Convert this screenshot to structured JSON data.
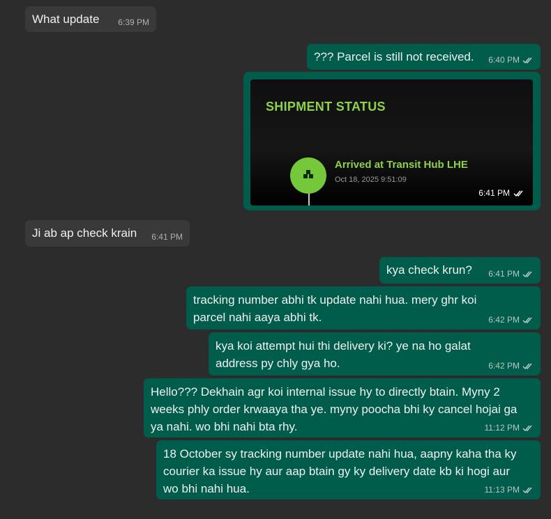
{
  "messages": [
    {
      "text": "What update",
      "time": "6:39 PM"
    },
    {
      "text": "??? Parcel is still not received.",
      "time": "6:40 PM"
    },
    {
      "text": "Ji ab ap check krain",
      "time": "6:41 PM"
    },
    {
      "text": "kya check krun?",
      "time": "6:41 PM"
    },
    {
      "text": "tracking number abhi tk update nahi hua. mery ghr koi parcel nahi aaya abhi tk.",
      "time": "6:42 PM"
    },
    {
      "text": "kya koi attempt hui thi delivery ki? ye na ho galat address py chly gya ho.",
      "time": "6:42 PM"
    },
    {
      "text": "Hello??? Dekhain agr koi internal issue hy to directly btain. Myny 2 weeks phly order krwaaya tha ye. myny poocha bhi ky cancel hojai ga ya nahi. wo bhi nahi bta rhy.",
      "time": "11:12 PM"
    },
    {
      "text": "18 October sy tracking number update nahi hua, aapny kaha tha ky courier ka issue hy aur aap btain gy ky delivery date kb ki hogi aur wo bhi nahi hua.",
      "time": "11:13 PM"
    }
  ],
  "shipment_card": {
    "title": "SHIPMENT STATUS",
    "stage": "Arrived at Transit Hub LHE",
    "stage_time": "Oct 18, 2025 9:51:09",
    "time": "6:41 PM"
  },
  "colors": {
    "background": "#2c2c2c",
    "incoming_bubble": "#393939",
    "outgoing_bubble": "#005c4b",
    "accent_green": "#8fd14b"
  },
  "icons": {
    "read_receipt": "double-check-icon",
    "stage_icon": "package-icon"
  }
}
